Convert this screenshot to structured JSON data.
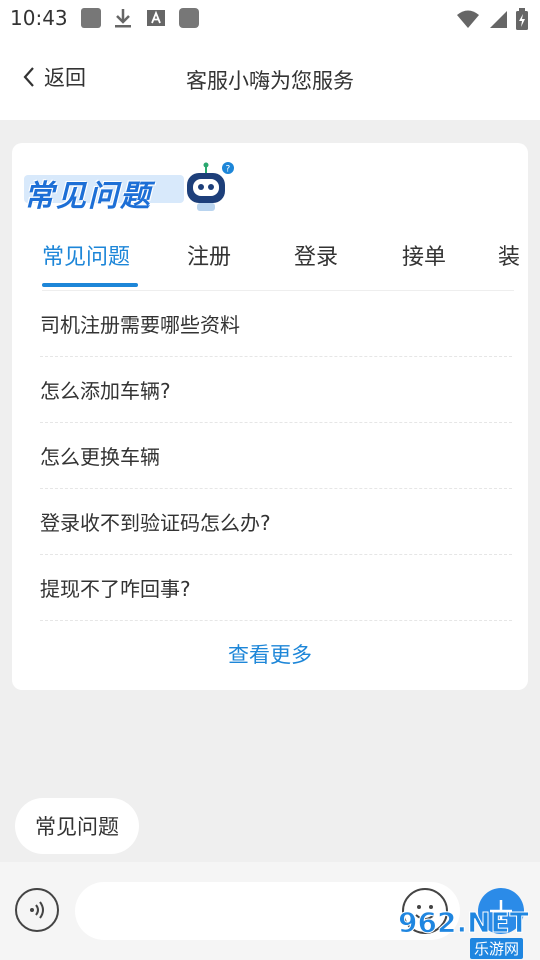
{
  "status_bar": {
    "time": "10:43",
    "icons": [
      "notification-square-icon",
      "download-icon",
      "text-a-icon",
      "notification-square-icon"
    ],
    "right_icons": [
      "wifi-icon",
      "signal-icon",
      "battery-icon"
    ]
  },
  "header": {
    "back_label": "返回",
    "title": "客服小嗨为您服务"
  },
  "faq": {
    "banner_text": "常见问题",
    "tabs": [
      {
        "label": "常见问题",
        "active": true
      },
      {
        "label": "注册",
        "active": false
      },
      {
        "label": "登录",
        "active": false
      },
      {
        "label": "接单",
        "active": false
      },
      {
        "label": "装",
        "active": false
      }
    ],
    "items": [
      "司机注册需要哪些资料",
      "怎么添加车辆?",
      "怎么更换车辆",
      "登录收不到验证码怎么办?",
      "提现不了咋回事?"
    ],
    "view_more": "查看更多"
  },
  "chat": {
    "bubble_text": "常见问题"
  },
  "input_bar": {
    "placeholder": ""
  },
  "watermark": {
    "top": "962.NET",
    "bottom": "乐游网"
  },
  "colors": {
    "accent": "#1d86d8",
    "background": "#efefef",
    "plus_button": "#2b8be8"
  }
}
